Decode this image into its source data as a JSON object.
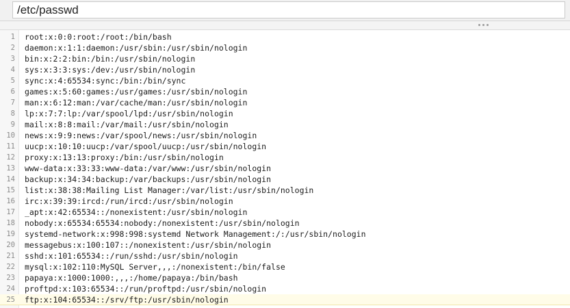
{
  "path_bar": {
    "value": "/etc/passwd"
  },
  "splitter": {
    "icon": "drag-handle-icon"
  },
  "editor": {
    "current_line": 25,
    "lines": [
      {
        "number": "1",
        "text": "root:x:0:0:root:/root:/bin/bash"
      },
      {
        "number": "2",
        "text": "daemon:x:1:1:daemon:/usr/sbin:/usr/sbin/nologin"
      },
      {
        "number": "3",
        "text": "bin:x:2:2:bin:/bin:/usr/sbin/nologin"
      },
      {
        "number": "4",
        "text": "sys:x:3:3:sys:/dev:/usr/sbin/nologin"
      },
      {
        "number": "5",
        "text": "sync:x:4:65534:sync:/bin:/bin/sync"
      },
      {
        "number": "6",
        "text": "games:x:5:60:games:/usr/games:/usr/sbin/nologin"
      },
      {
        "number": "7",
        "text": "man:x:6:12:man:/var/cache/man:/usr/sbin/nologin"
      },
      {
        "number": "8",
        "text": "lp:x:7:7:lp:/var/spool/lpd:/usr/sbin/nologin"
      },
      {
        "number": "9",
        "text": "mail:x:8:8:mail:/var/mail:/usr/sbin/nologin"
      },
      {
        "number": "10",
        "text": "news:x:9:9:news:/var/spool/news:/usr/sbin/nologin"
      },
      {
        "number": "11",
        "text": "uucp:x:10:10:uucp:/var/spool/uucp:/usr/sbin/nologin"
      },
      {
        "number": "12",
        "text": "proxy:x:13:13:proxy:/bin:/usr/sbin/nologin"
      },
      {
        "number": "13",
        "text": "www-data:x:33:33:www-data:/var/www:/usr/sbin/nologin"
      },
      {
        "number": "14",
        "text": "backup:x:34:34:backup:/var/backups:/usr/sbin/nologin"
      },
      {
        "number": "15",
        "text": "list:x:38:38:Mailing List Manager:/var/list:/usr/sbin/nologin"
      },
      {
        "number": "16",
        "text": "irc:x:39:39:ircd:/run/ircd:/usr/sbin/nologin"
      },
      {
        "number": "17",
        "text": "_apt:x:42:65534::/nonexistent:/usr/sbin/nologin"
      },
      {
        "number": "18",
        "text": "nobody:x:65534:65534:nobody:/nonexistent:/usr/sbin/nologin"
      },
      {
        "number": "19",
        "text": "systemd-network:x:998:998:systemd Network Management:/:/usr/sbin/nologin"
      },
      {
        "number": "20",
        "text": "messagebus:x:100:107::/nonexistent:/usr/sbin/nologin"
      },
      {
        "number": "21",
        "text": "sshd:x:101:65534::/run/sshd:/usr/sbin/nologin"
      },
      {
        "number": "22",
        "text": "mysql:x:102:110:MySQL Server,,,:/nonexistent:/bin/false"
      },
      {
        "number": "23",
        "text": "papaya:x:1000:1000:,,,:/home/papaya:/bin/bash"
      },
      {
        "number": "24",
        "text": "proftpd:x:103:65534::/run/proftpd:/usr/sbin/nologin"
      },
      {
        "number": "25",
        "text": "ftp:x:104:65534::/srv/ftp:/usr/sbin/nologin"
      }
    ]
  }
}
